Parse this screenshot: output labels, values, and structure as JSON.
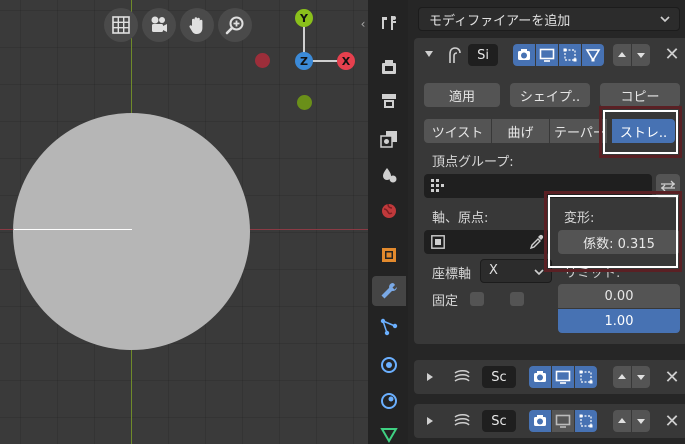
{
  "viewport": {
    "tools": [
      "grid-icon",
      "camera-icon",
      "hand-icon",
      "zoom-icon"
    ],
    "gizmo": {
      "y_label": "Y",
      "z_label": "Z",
      "x_label": "X"
    }
  },
  "properties": {
    "add_modifier": "モディファイアーを追加",
    "modifier1": {
      "name": "Si",
      "apply": "適用",
      "shape": "シェイプ..",
      "copy": "コピー",
      "modes": [
        "ツイスト",
        "曲げ",
        "テーパー",
        "ストレ.."
      ],
      "selected_mode": "ストレ..",
      "vertex_group_label": "頂点グループ:",
      "axis_origin_label": "軸、原点:",
      "deform_label": "変形:",
      "factor": "係数: 0.315",
      "coord_axis_label": "座標軸",
      "coord_axis_value": "X",
      "lock_label": "固定",
      "limits_label": "リミット:",
      "limit_min": "0.00",
      "limit_max": "1.00"
    },
    "modifier2": {
      "name": "Sc"
    },
    "modifier3": {
      "name": "Sc"
    }
  },
  "colors": {
    "accent": "#4772b3",
    "x_axis": "#e6404e",
    "y_axis": "#8ac01b",
    "z_axis": "#3b8ad8",
    "highlight": "#5a2024"
  }
}
